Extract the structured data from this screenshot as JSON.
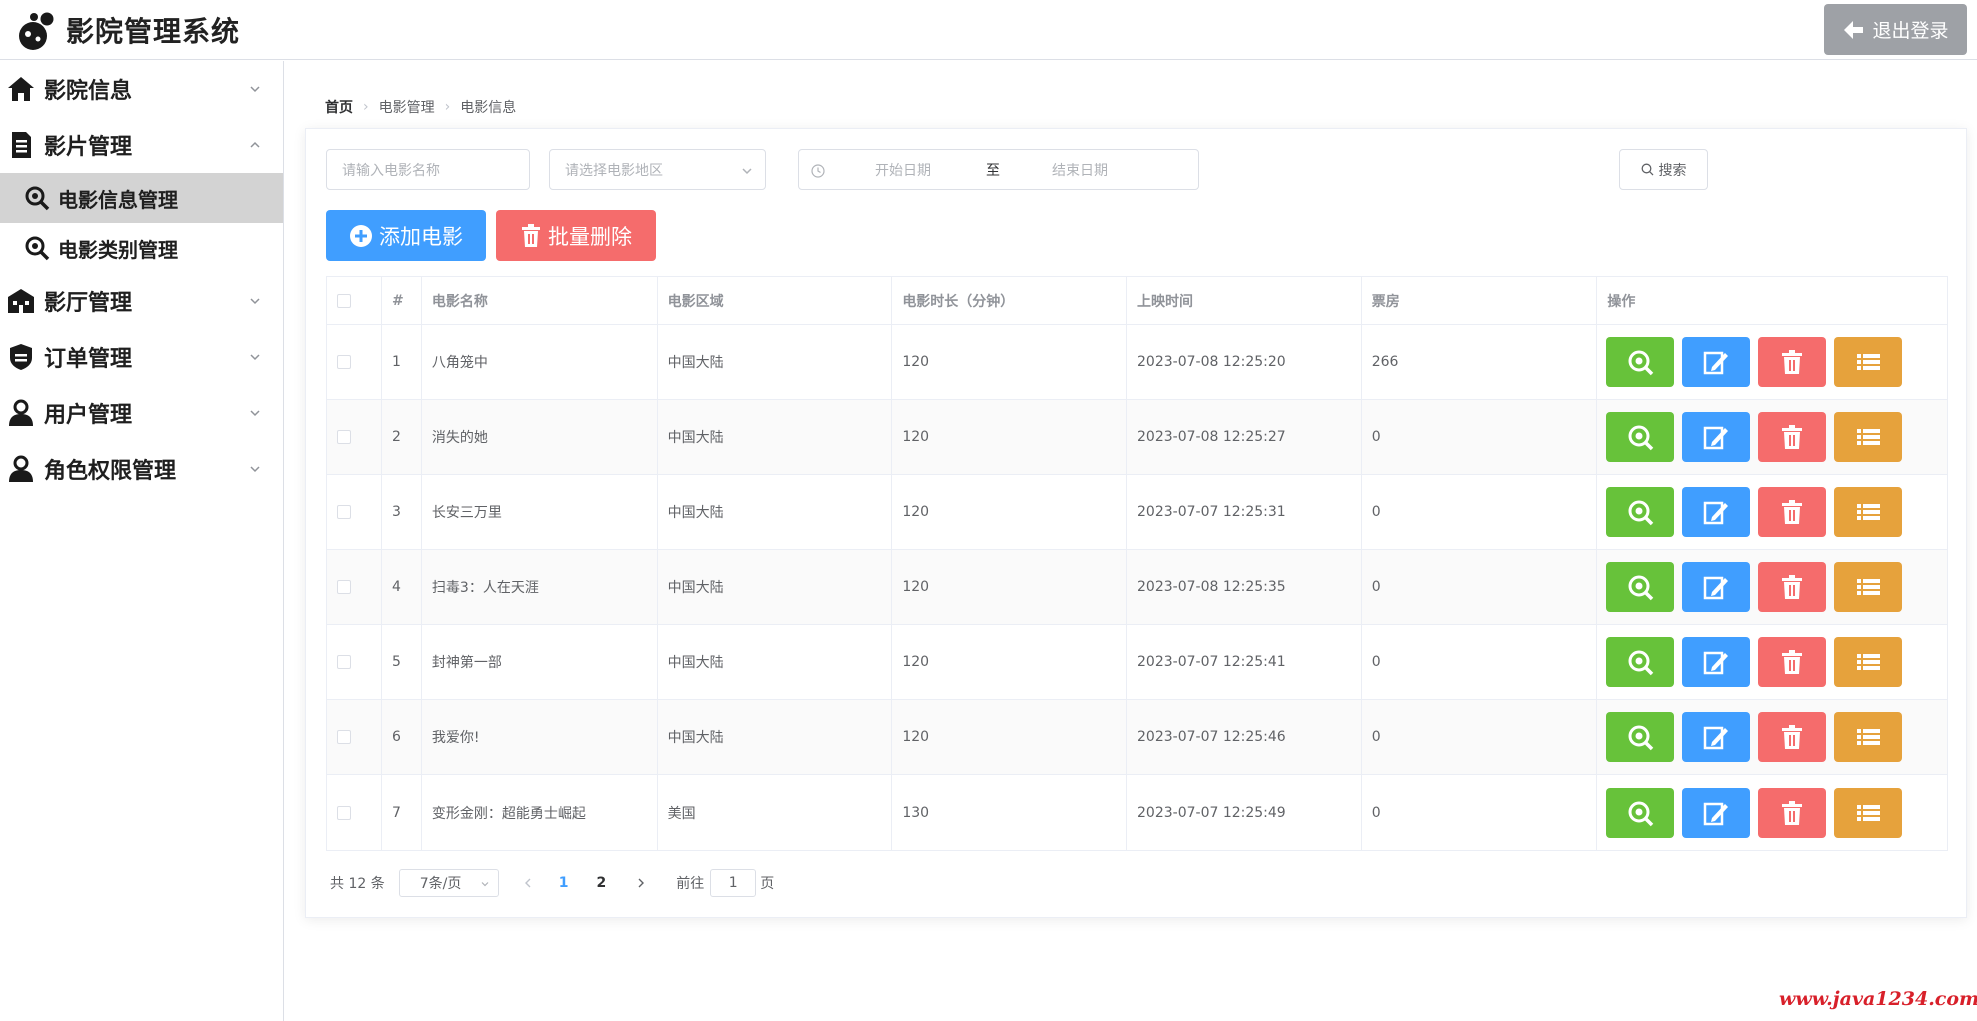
{
  "app": {
    "title": "影院管理系统",
    "logout_label": "退出登录"
  },
  "sidebar": {
    "items": [
      {
        "label": "影院信息",
        "icon": "home-icon",
        "expanded": false
      },
      {
        "label": "影片管理",
        "icon": "document-icon",
        "expanded": true,
        "children": [
          {
            "label": "电影信息管理",
            "icon": "search-icon",
            "active": true
          },
          {
            "label": "电影类别管理",
            "icon": "search-icon",
            "active": false
          }
        ]
      },
      {
        "label": "影厅管理",
        "icon": "building-icon",
        "expanded": false
      },
      {
        "label": "订单管理",
        "icon": "badge-icon",
        "expanded": false
      },
      {
        "label": "用户管理",
        "icon": "user-icon",
        "expanded": false
      },
      {
        "label": "角色权限管理",
        "icon": "user-icon",
        "expanded": false
      }
    ]
  },
  "breadcrumb": [
    "首页",
    "电影管理",
    "电影信息"
  ],
  "filters": {
    "name_placeholder": "请输入电影名称",
    "region_placeholder": "请选择电影地区",
    "start_placeholder": "开始日期",
    "range_sep": "至",
    "end_placeholder": "结束日期",
    "search_label": "搜索"
  },
  "actions": {
    "add_label": "添加电影",
    "batch_delete_label": "批量删除"
  },
  "table": {
    "columns": [
      "#",
      "电影名称",
      "电影区域",
      "电影时长（分钟）",
      "上映时间",
      "票房",
      "操作"
    ],
    "rows": [
      {
        "idx": "1",
        "name": "八角笼中",
        "region": "中国大陆",
        "duration": "120",
        "release": "2023-07-08 12:25:20",
        "box": "266"
      },
      {
        "idx": "2",
        "name": "消失的她",
        "region": "中国大陆",
        "duration": "120",
        "release": "2023-07-08 12:25:27",
        "box": "0"
      },
      {
        "idx": "3",
        "name": "长安三万里",
        "region": "中国大陆",
        "duration": "120",
        "release": "2023-07-07 12:25:31",
        "box": "0"
      },
      {
        "idx": "4",
        "name": "扫毒3：人在天涯",
        "region": "中国大陆",
        "duration": "120",
        "release": "2023-07-08 12:25:35",
        "box": "0"
      },
      {
        "idx": "5",
        "name": "封神第一部",
        "region": "中国大陆",
        "duration": "120",
        "release": "2023-07-07 12:25:41",
        "box": "0"
      },
      {
        "idx": "6",
        "name": "我爱你!",
        "region": "中国大陆",
        "duration": "120",
        "release": "2023-07-07 12:25:46",
        "box": "0"
      },
      {
        "idx": "7",
        "name": "变形金刚：超能勇士崛起",
        "region": "美国",
        "duration": "130",
        "release": "2023-07-07 12:25:49",
        "box": "0"
      }
    ],
    "row_actions": [
      {
        "icon": "view-icon",
        "color": "#67c23a"
      },
      {
        "icon": "edit-icon",
        "color": "#409eff"
      },
      {
        "icon": "delete-icon",
        "color": "#f56c6c"
      },
      {
        "icon": "list-icon",
        "color": "#e6a23c"
      }
    ]
  },
  "pagination": {
    "total": "共 12 条",
    "page_size": "7条/页",
    "pages": [
      "1",
      "2"
    ],
    "current_page": "1",
    "goto_prefix": "前往",
    "goto_value": "1",
    "goto_suffix": "页"
  },
  "watermark": "www.java1234.com",
  "colors": {
    "success": "#67c23a",
    "primary": "#409eff",
    "danger": "#f56c6c",
    "warning": "#e6a23c"
  }
}
